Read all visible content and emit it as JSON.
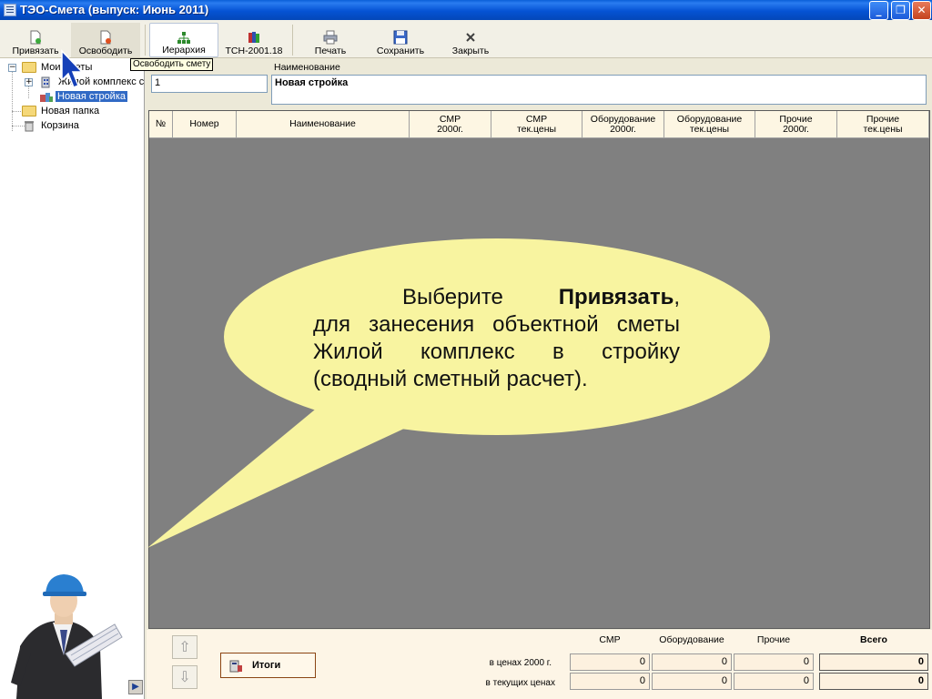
{
  "window": {
    "title": "ТЭО-Смета  (выпуск: Июнь 2011)",
    "minimize_glyph": "_",
    "maximize_glyph": "❐",
    "close_glyph": "✕"
  },
  "toolbar": {
    "attach_label": "Привязать",
    "release_label": "Освободить",
    "hierarchy_label": "Иерархия",
    "tsn_label": "ТСН-2001.18",
    "print_label": "Печать",
    "save_label": "Сохранить",
    "close_label": "Закрыть"
  },
  "tooltip": {
    "text": "Освободить смету"
  },
  "tree": {
    "items": [
      {
        "label": "Мои сметы",
        "icon": "folder-open-icon",
        "expander": "−"
      },
      {
        "label": "Жилой комплекс с",
        "icon": "building-icon",
        "expander": "+"
      },
      {
        "label": "Новая стройка",
        "icon": "construction-icon",
        "selected": true
      },
      {
        "label": "Новая папка",
        "icon": "folder-icon"
      },
      {
        "label": "Корзина",
        "icon": "trash-icon"
      }
    ],
    "splitter_glyph": "▶"
  },
  "fields": {
    "number_value": "1",
    "name_label": "Наименование",
    "name_value": "Новая стройка"
  },
  "grid": {
    "columns": [
      {
        "label": "№"
      },
      {
        "label": "Номер"
      },
      {
        "label": "Наименование"
      },
      {
        "label": "СМР\n2000г."
      },
      {
        "label": "СМР\nтек.цены"
      },
      {
        "label": "Оборудование\n2000г."
      },
      {
        "label": "Оборудование\nтек.цены"
      },
      {
        "label": "Прочие\n2000г."
      },
      {
        "label": "Прочие\nтек.цены"
      }
    ]
  },
  "callout": {
    "word1": "Выберите",
    "bold_word": "Привязать",
    "after_bold": ",",
    "rest": "для занесения объектной сметы Жилой комплекс в стройку (сводный сметный расчет).",
    "bg_color": "#f8f4a0"
  },
  "totals": {
    "up_glyph": "⇧",
    "down_glyph": "⇩",
    "itogi_label": "Итоги",
    "headers": {
      "smr": "СМР",
      "equipment": "Оборудование",
      "other": "Прочие",
      "total": "Всего"
    },
    "rows": [
      {
        "label": "в ценах 2000 г.",
        "smr": "0",
        "equipment": "0",
        "other": "0",
        "total": "0"
      },
      {
        "label": "в текущих ценах",
        "smr": "0",
        "equipment": "0",
        "other": "0",
        "total": "0"
      }
    ]
  },
  "colors": {
    "titlebar": "#0553d4",
    "selection": "#316ac5",
    "grid_bg": "#808080",
    "callout": "#f8f4a0"
  }
}
